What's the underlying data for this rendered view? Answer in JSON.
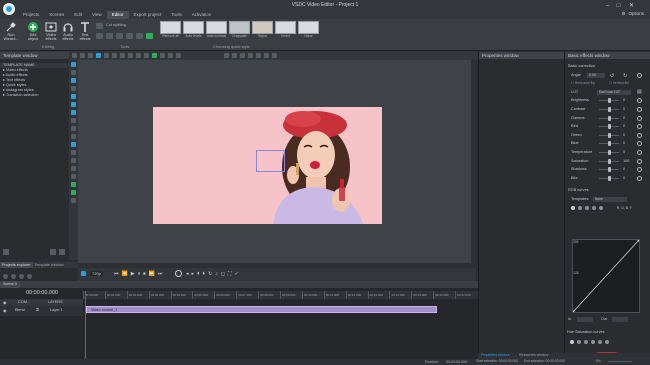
{
  "app": {
    "title": "VSDC Video Editor - Project 1",
    "menu_tabs": [
      "Projects",
      "Scenes",
      "Edit",
      "View",
      "Editor",
      "Export project",
      "Tools",
      "Activation"
    ],
    "active_tab": "Editor",
    "account": "Options"
  },
  "ribbon": {
    "buttons": [
      {
        "label": "Run Wizard...",
        "icon": "wizard-icon"
      },
      {
        "label": "Add object",
        "icon": "add-object-icon"
      },
      {
        "label": "Video effects",
        "icon": "video-effects-icon"
      },
      {
        "label": "Audio effects",
        "icon": "audio-effects-icon"
      },
      {
        "label": "Text effects",
        "icon": "text-effects-icon"
      }
    ],
    "groups": {
      "editing": "Editing",
      "tools": "Tools",
      "quick_style": "Choosing quick style"
    },
    "cut_label": "Cut splitting",
    "quick_styles": [
      "Remove all",
      "Auto levels",
      "Auto contrast",
      "Grayscale",
      "Sepia",
      "Invert",
      "Noise"
    ]
  },
  "left_panel": {
    "title": "Template window",
    "section": "TEMPLATE NAME",
    "items": [
      "Video effects",
      "Audio effects",
      "Text effects",
      "Quick styles",
      "Instagram styles",
      "Transition selection"
    ]
  },
  "explorer": {
    "tabs": [
      "Projects explorer",
      "Template window"
    ]
  },
  "playbar": {
    "zoom": "720p",
    "time": "00:00:00.000"
  },
  "timeline": {
    "tabs": [
      "Scene 0"
    ],
    "timecode": "00:00:00.000",
    "layers_label": "LAYERS",
    "com_label": "COM...",
    "blend_label": "Blend",
    "layer_name": "Layer 1",
    "clip_label": "Video source_1",
    "ruler_marks": [
      "00:00.000",
      "00:01.000",
      "00:02.000",
      "00:03.000",
      "00:04.000",
      "00:05.000",
      "00:06.000",
      "00:07.000",
      "00:08.000",
      "00:09.000",
      "00:10.000",
      "00:11.000",
      "00:12.000",
      "00:13.000",
      "00:14.000",
      "00:15.000",
      "00:16.000",
      "00:17.000"
    ]
  },
  "properties": {
    "title": "Properties window"
  },
  "effects": {
    "title": "Basic effects window",
    "basic_correction": "Basic correction",
    "angle_label": "Angle",
    "angle_value": "0.00",
    "checks": [
      "Horizontal flip",
      "Vertical flip"
    ],
    "lut_label": "LUT",
    "lut_value": "Don't use LUT",
    "rows": [
      {
        "label": "Brightness",
        "value": "0"
      },
      {
        "label": "Contrast",
        "value": "0"
      },
      {
        "label": "Gamma",
        "value": "0"
      },
      {
        "label": "Red",
        "value": "0"
      },
      {
        "label": "Green",
        "value": "0"
      },
      {
        "label": "Blue",
        "value": "0"
      },
      {
        "label": "Temperature",
        "value": "0"
      },
      {
        "label": "Saturation",
        "value": "100"
      },
      {
        "label": "Shadows",
        "value": "0"
      },
      {
        "label": "Blur",
        "value": "0"
      }
    ],
    "rgb_curves": "RGB curves",
    "templates_label": "Templates:",
    "templates_value": "None",
    "channels": "R, G, B, Y",
    "curve_max": "255",
    "curve_mid": "128",
    "in_label": "In:",
    "out_label": "Out:",
    "hue_saturation": "Hue Saturation curves"
  },
  "bottom_tabs": [
    "Properties window",
    "Resources window"
  ],
  "status": {
    "position_label": "Position:",
    "position_value": "00:00:00.000",
    "start_label": "Start selection:",
    "start_value": "00:00:00.000",
    "end_label": "End selection:",
    "end_value": "00:00:00.000",
    "zoom": "0%"
  },
  "colors": {
    "accent": "#2a9fd8",
    "clip": "#a58ccd",
    "photo_bg": "#f6c4c8",
    "playhead": "#d83b3b"
  }
}
